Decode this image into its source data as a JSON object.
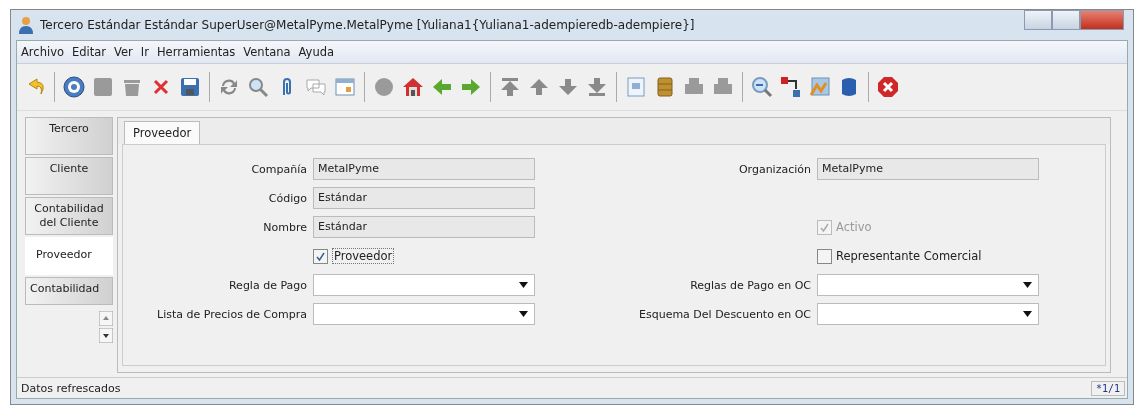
{
  "window": {
    "title": "Tercero  Estándar  Estándar  SuperUser@MetalPyme.MetalPyme [Yuliana1{Yuliana1-adempieredb-adempiere}]"
  },
  "menu": [
    "Archivo",
    "Editar",
    "Ver",
    "Ir",
    "Herramientas",
    "Ventana",
    "Ayuda"
  ],
  "side_tabs": [
    {
      "label": "Tercero",
      "selected": false
    },
    {
      "label": "Cliente",
      "selected": false
    },
    {
      "label": "Contabilidad del Cliente",
      "selected": false
    },
    {
      "label": "Proveedor",
      "selected": true
    },
    {
      "label": "Contabilidad",
      "selected": false
    }
  ],
  "tabs": [
    {
      "label": "Proveedor",
      "selected": true
    }
  ],
  "form": {
    "left": [
      {
        "kind": "text",
        "label": "Compañía",
        "value": "MetalPyme"
      },
      {
        "kind": "text",
        "label": "Código",
        "value": "Estándar"
      },
      {
        "kind": "text",
        "label": "Nombre",
        "value": "Estándar"
      },
      {
        "kind": "checkbox",
        "label": "Proveedor",
        "checked": true,
        "disabled": false
      },
      {
        "kind": "select",
        "label": "Regla de Pago"
      },
      {
        "kind": "select",
        "label": "Lista de Precios de Compra"
      }
    ],
    "right": [
      {
        "kind": "text",
        "label": "Organización",
        "value": "MetalPyme"
      },
      {
        "kind": "blank"
      },
      {
        "kind": "checkbox",
        "label": "Activo",
        "checked": true,
        "disabled": true
      },
      {
        "kind": "checkbox",
        "label": "Representante Comercial",
        "checked": false,
        "disabled": false
      },
      {
        "kind": "select",
        "label": "Reglas de Pago en OC"
      },
      {
        "kind": "select",
        "label": "Esquema Del Descuento en OC"
      }
    ]
  },
  "status_bar": {
    "message": "Datos refrescados",
    "record": "*1/1"
  }
}
